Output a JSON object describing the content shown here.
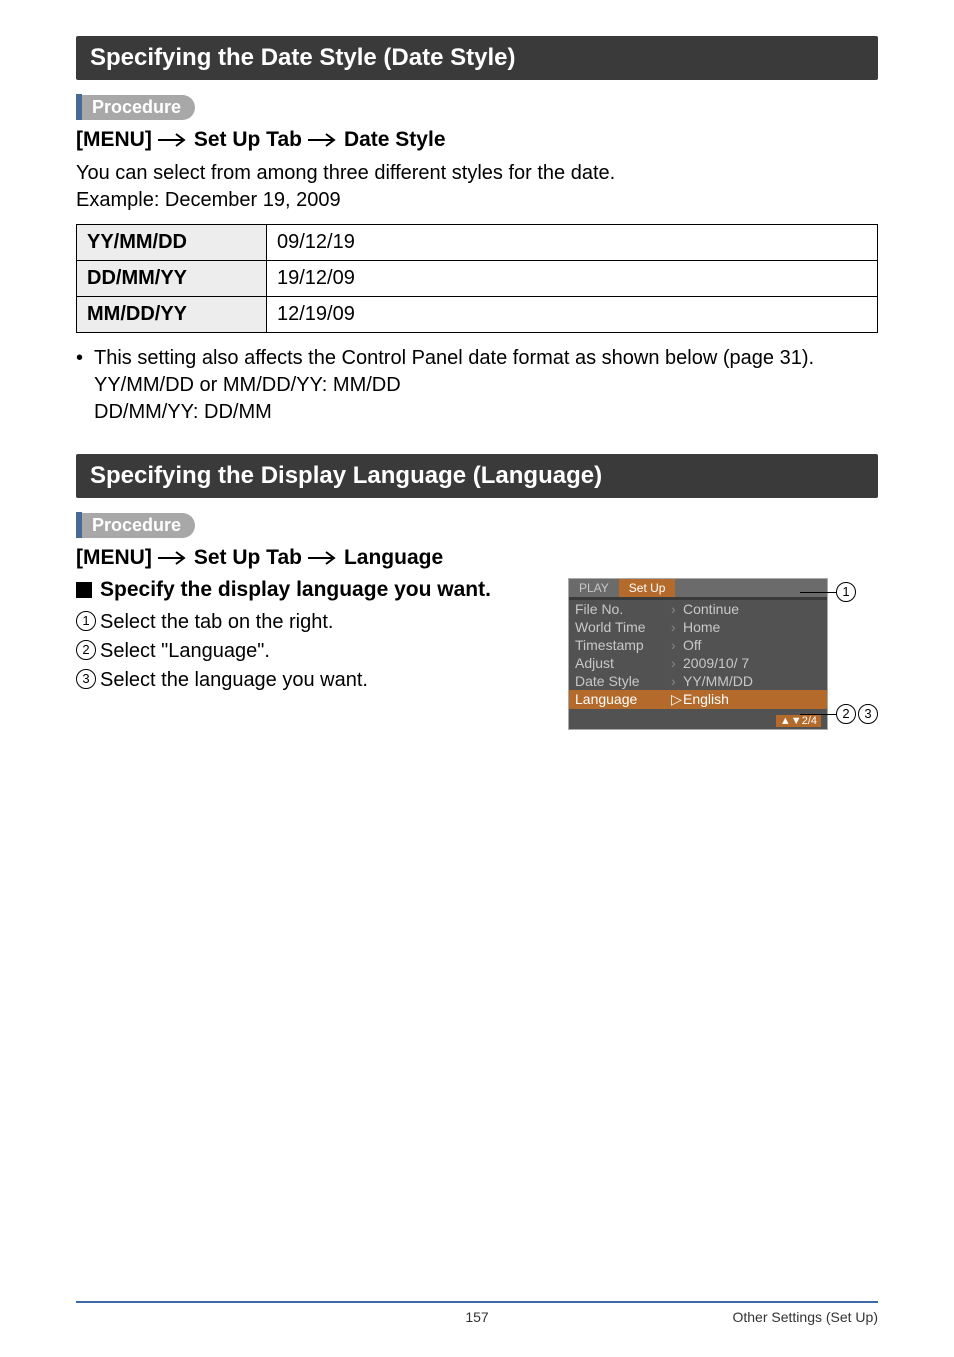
{
  "section1": {
    "title": "Specifying the Date Style (Date Style)",
    "procedure_label": "Procedure",
    "crumb": {
      "a": "[MENU]",
      "b": "Set Up Tab",
      "c": "Date Style"
    },
    "desc_line1": "You can select from among three different styles for the date.",
    "desc_line2": "Example: December 19, 2009",
    "table": {
      "rows": [
        {
          "k": "YY/MM/DD",
          "v": "09/12/19"
        },
        {
          "k": "DD/MM/YY",
          "v": "19/12/09"
        },
        {
          "k": "MM/DD/YY",
          "v": "12/19/09"
        }
      ]
    },
    "note_line1": "This setting also affects the Control Panel date format as shown below (page 31).",
    "note_line2": "YY/MM/DD or MM/DD/YY: MM/DD",
    "note_line3": "DD/MM/YY: DD/MM"
  },
  "section2": {
    "title": "Specifying the Display Language (Language)",
    "procedure_label": "Procedure",
    "crumb": {
      "a": "[MENU]",
      "b": "Set Up Tab",
      "c": "Language"
    },
    "sub_heading": "Specify the display language you want.",
    "steps": [
      "Select the tab on the right.",
      "Select \"Language\".",
      "Select the language you want."
    ],
    "camera_menu": {
      "tabs": {
        "play": "PLAY",
        "setup": "Set Up"
      },
      "rows": [
        {
          "k": "File No.",
          "v": "Continue"
        },
        {
          "k": "World Time",
          "v": "Home"
        },
        {
          "k": "Timestamp",
          "v": "Off"
        },
        {
          "k": "Adjust",
          "v": "2009/10/  7"
        },
        {
          "k": "Date Style",
          "v": "YY/MM/DD"
        },
        {
          "k": "Language",
          "v": "English"
        }
      ],
      "footer": "▲▼2/4"
    },
    "callouts": {
      "c1": "1",
      "c2": "2",
      "c3": "3"
    }
  },
  "footer": {
    "page_num": "157",
    "section_name": "Other Settings (Set Up)"
  }
}
